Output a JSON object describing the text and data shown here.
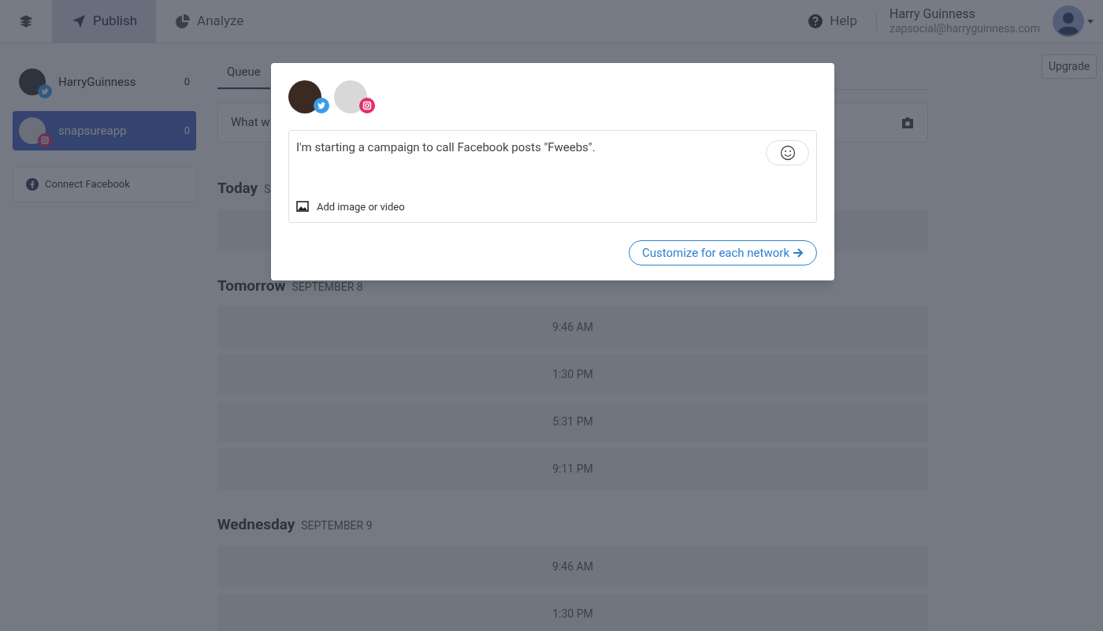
{
  "nav": {
    "items": [
      {
        "label": "Publish",
        "kind": "publish",
        "selected": true
      },
      {
        "label": "Analyze",
        "kind": "analyze",
        "selected": false
      }
    ],
    "help": "Help",
    "user_name": "Harry Guinness",
    "user_email": "zapsocial@harryguinness.com"
  },
  "sidebar": {
    "accounts": [
      {
        "name": "HarryGuinness",
        "count": "0",
        "kind": "twitter",
        "selected": false
      },
      {
        "name": "snapsureapp",
        "count": "0",
        "kind": "instagram",
        "selected": true
      }
    ],
    "connect": "Connect Facebook"
  },
  "main": {
    "tabs": [
      {
        "label": "Queue",
        "selected": true
      }
    ],
    "upgrade": "Upgrade",
    "composer_placeholder": "What w",
    "days": [
      {
        "day": "Today",
        "date": "S",
        "slots": [
          {
            "kind": "blank"
          }
        ]
      },
      {
        "day": "Tomorrow",
        "date": "SEPTEMBER 8",
        "slots": [
          {
            "kind": "time",
            "time": "9:46 AM"
          },
          {
            "kind": "time",
            "time": "1:30 PM"
          },
          {
            "kind": "time",
            "time": "5:31 PM"
          },
          {
            "kind": "time",
            "time": "9:11 PM"
          }
        ]
      },
      {
        "day": "Wednesday",
        "date": "SEPTEMBER 9",
        "slots": [
          {
            "kind": "time",
            "time": "9:46 AM"
          },
          {
            "kind": "time",
            "time": "1:30 PM"
          }
        ]
      }
    ]
  },
  "modal": {
    "accounts": [
      {
        "kind": "twitter",
        "photo": true
      },
      {
        "kind": "instagram",
        "photo": false
      }
    ],
    "text": "I'm starting a campaign to call Facebook posts \"Fweebs\".",
    "add_media": "Add image or video",
    "customize": "Customize for each network"
  }
}
